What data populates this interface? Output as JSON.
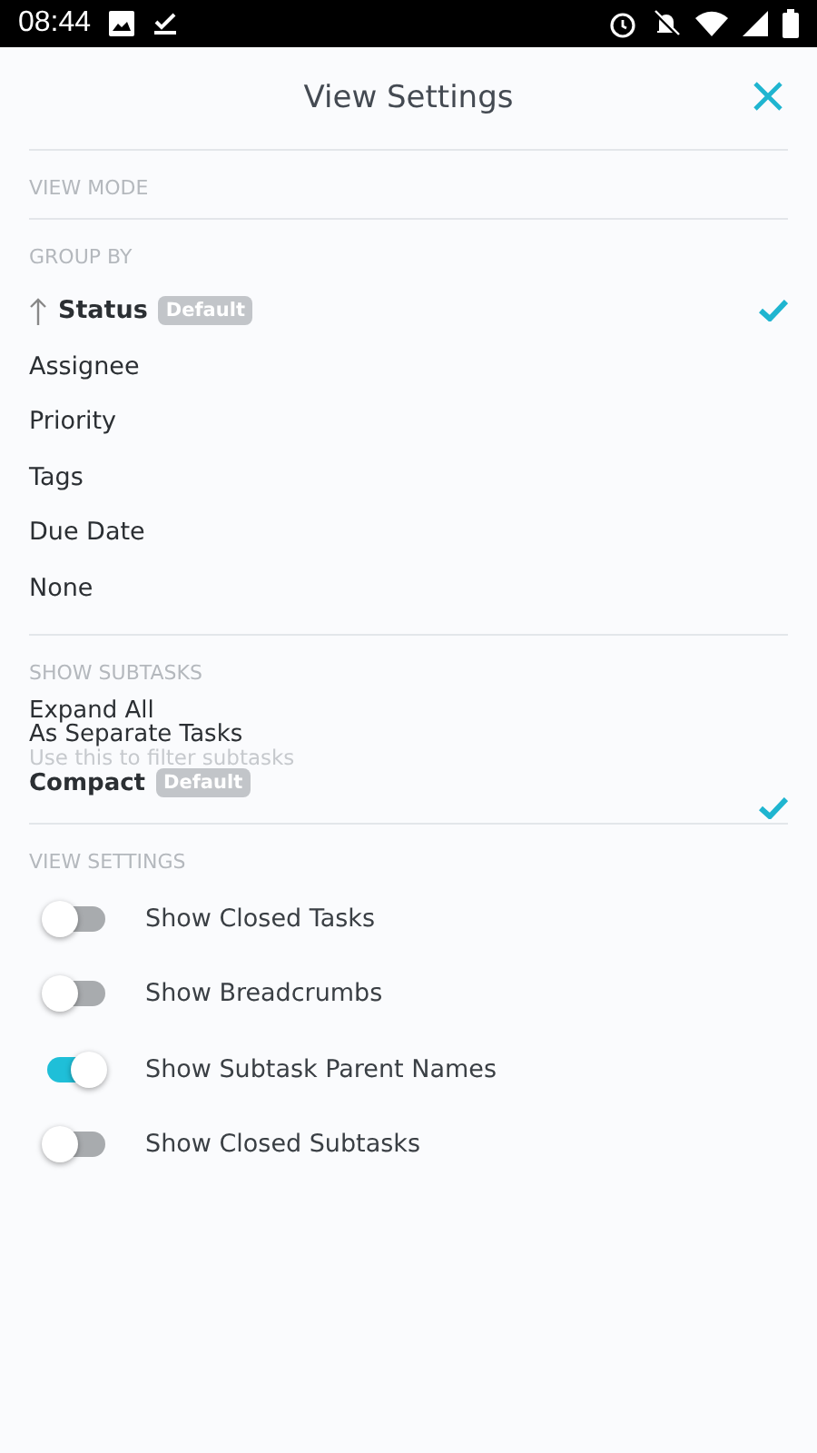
{
  "status_bar": {
    "time": "08:44"
  },
  "header": {
    "title": "View Settings"
  },
  "view_mode": {
    "heading": "VIEW MODE"
  },
  "group_by": {
    "heading": "GROUP BY",
    "items": [
      {
        "label": "Status",
        "badge": "Default",
        "selected": true
      },
      {
        "label": "Assignee",
        "selected": false
      },
      {
        "label": "Priority",
        "selected": false
      },
      {
        "label": "Tags",
        "selected": false
      },
      {
        "label": "Due Date",
        "selected": false
      },
      {
        "label": "None",
        "selected": false
      }
    ]
  },
  "show_subtasks": {
    "heading": "SHOW SUBTASKS",
    "items": [
      {
        "label": "Expand All",
        "selected": false
      },
      {
        "label": "As Separate Tasks",
        "hint": "Use this to filter subtasks",
        "selected": false
      },
      {
        "label": "Compact",
        "badge": "Default",
        "selected": true
      }
    ]
  },
  "view_settings": {
    "heading": "VIEW SETTINGS",
    "toggles": [
      {
        "label": "Show Closed Tasks",
        "on": false
      },
      {
        "label": "Show Breadcrumbs",
        "on": false
      },
      {
        "label": "Show Subtask Parent Names",
        "on": true
      },
      {
        "label": "Show Closed Subtasks",
        "on": false
      }
    ]
  }
}
